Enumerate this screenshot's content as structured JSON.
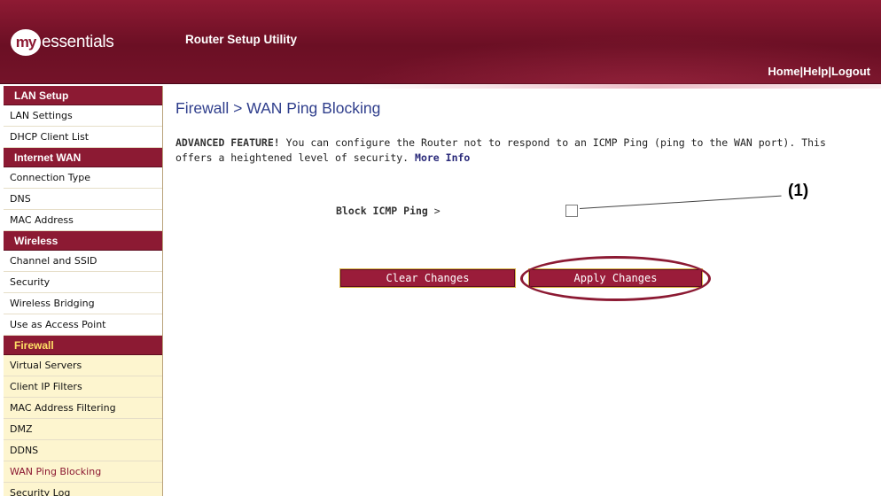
{
  "header": {
    "logo_prefix": "my",
    "logo_brand": "essentials",
    "app_title": "Router Setup Utility",
    "links": [
      "Home",
      "Help",
      "Logout"
    ],
    "separator": "|"
  },
  "sidebar": {
    "sections": [
      {
        "title": "LAN Setup",
        "active": false,
        "items": [
          "LAN Settings",
          "DHCP Client List"
        ]
      },
      {
        "title": "Internet WAN",
        "active": false,
        "items": [
          "Connection Type",
          "DNS",
          "MAC Address"
        ]
      },
      {
        "title": "Wireless",
        "active": false,
        "items": [
          "Channel and SSID",
          "Security",
          "Wireless Bridging",
          "Use as Access Point"
        ]
      },
      {
        "title": "Firewall",
        "active": true,
        "items": [
          "Virtual Servers",
          "Client IP Filters",
          "MAC Address Filtering",
          "DMZ",
          "DDNS",
          "WAN Ping Blocking",
          "Security Log"
        ],
        "current": "WAN Ping Blocking"
      }
    ]
  },
  "main": {
    "title": "Firewall > WAN Ping Blocking",
    "desc_bold": "ADVANCED FEATURE!",
    "desc_text": " You can configure the Router not to respond to an ICMP Ping (ping to the WAN port). This offers a heightened level of security. ",
    "more_info": "More Info",
    "block_label": "Block ICMP Ping",
    "block_suffix": " >",
    "block_checked": false,
    "callout": "(1)",
    "clear_button": "Clear Changes",
    "apply_button": "Apply Changes"
  },
  "colors": {
    "brand": "#8c1a33",
    "title_blue": "#2f3e8c",
    "firewall_highlight": "#ffe066",
    "firewall_item_bg": "#fdf5cf",
    "button_border": "#d8b54a"
  }
}
